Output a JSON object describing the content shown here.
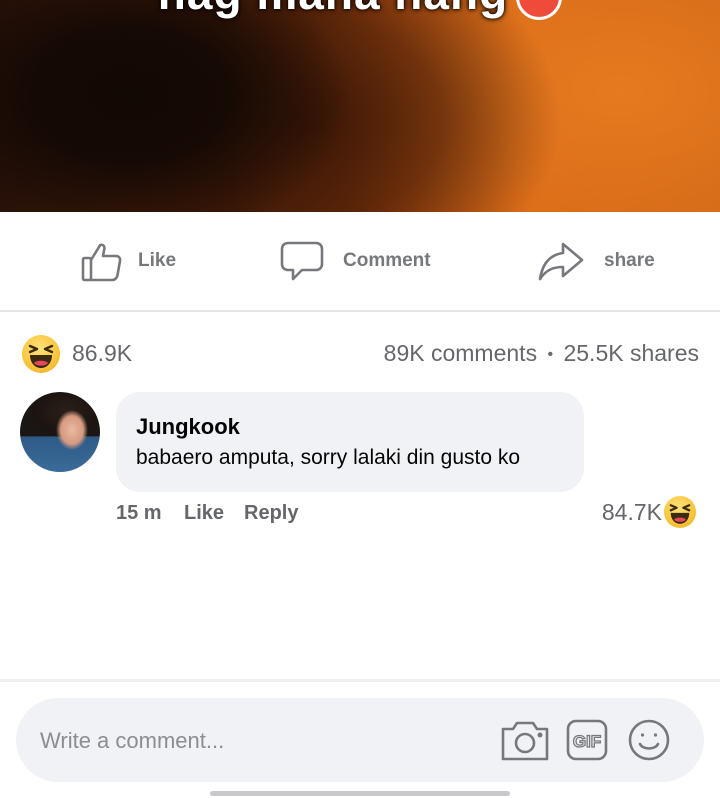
{
  "post": {
    "photo_caption_partial": "nag mana nang"
  },
  "actions": {
    "like": "Like",
    "comment": "Comment",
    "share": "share"
  },
  "stats": {
    "reaction_icon": "haha-reaction-icon",
    "reaction_count": "86.9K",
    "comments": "89K comments",
    "separator": "•",
    "shares": "25.5K shares"
  },
  "comment": {
    "author": "Jungkook",
    "text": "babaero amputa, sorry lalaki din gusto ko",
    "time": "15 m",
    "like": "Like",
    "reply": "Reply",
    "reaction_count": "84.7K",
    "reaction_icon": "haha-reaction-icon"
  },
  "composer": {
    "placeholder": "Write a comment...",
    "icons": [
      "camera-icon",
      "gif-icon",
      "emoji-icon"
    ],
    "gif_label": "GIF"
  },
  "colors": {
    "reaction_yellow": "#f7c43a",
    "text_gray": "#65676b",
    "bubble_bg": "#f0f2f5"
  }
}
